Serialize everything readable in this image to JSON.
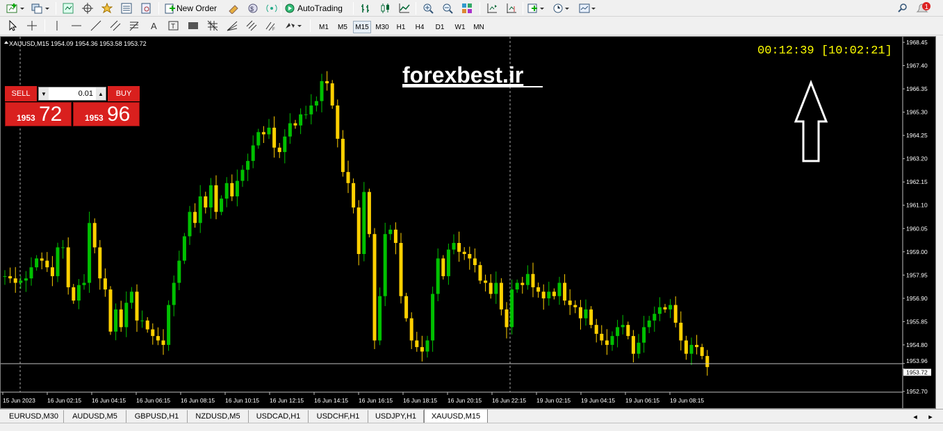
{
  "toolbar1": {
    "new_order": "New Order",
    "auto_trading": "AutoTrading",
    "notification_count": "1"
  },
  "timeframes": [
    "M1",
    "M5",
    "M15",
    "M30",
    "H1",
    "H4",
    "D1",
    "W1",
    "MN"
  ],
  "active_timeframe": "M15",
  "chart": {
    "header": "XAUUSD,M15  1954.09 1954.36 1953.58 1953.72",
    "watermark": "forexbest.ir",
    "countdown": "00:12:39 [10:02:21]",
    "price_axis": [
      "1968.45",
      "1967.40",
      "1966.35",
      "1965.30",
      "1964.25",
      "1963.20",
      "1962.15",
      "1961.10",
      "1960.05",
      "1959.00",
      "1957.95",
      "1956.90",
      "1955.85",
      "1954.80",
      "1953.96",
      "1953.72",
      "1952.70"
    ],
    "time_axis": [
      "15 Jun 2023",
      "16 Jun 02:15",
      "16 Jun 04:15",
      "16 Jun 06:15",
      "16 Jun 08:15",
      "16 Jun 10:15",
      "16 Jun 12:15",
      "16 Jun 14:15",
      "16 Jun 16:15",
      "16 Jun 18:15",
      "16 Jun 20:15",
      "16 Jun 22:15",
      "19 Jun 02:15",
      "19 Jun 04:15",
      "19 Jun 06:15",
      "19 Jun 08:15"
    ],
    "bid_line": "1953.96",
    "current_price": "1953.72",
    "colors": {
      "bull": "#00c000",
      "bear": "#ffd000",
      "countdown": "#ffff00"
    }
  },
  "trade_panel": {
    "sell_label": "SELL",
    "buy_label": "BUY",
    "lot": "0.01",
    "sell_small": "1953",
    "sell_big": "72",
    "buy_small": "1953",
    "buy_big": "96"
  },
  "tabs": [
    "EURUSD,M30",
    "AUDUSD,M5",
    "GBPUSD,H1",
    "NZDUSD,M5",
    "USDCAD,H1",
    "USDCHF,H1",
    "USDJPY,H1",
    "XAUUSD,M15"
  ],
  "active_tab": "XAUUSD,M15"
}
